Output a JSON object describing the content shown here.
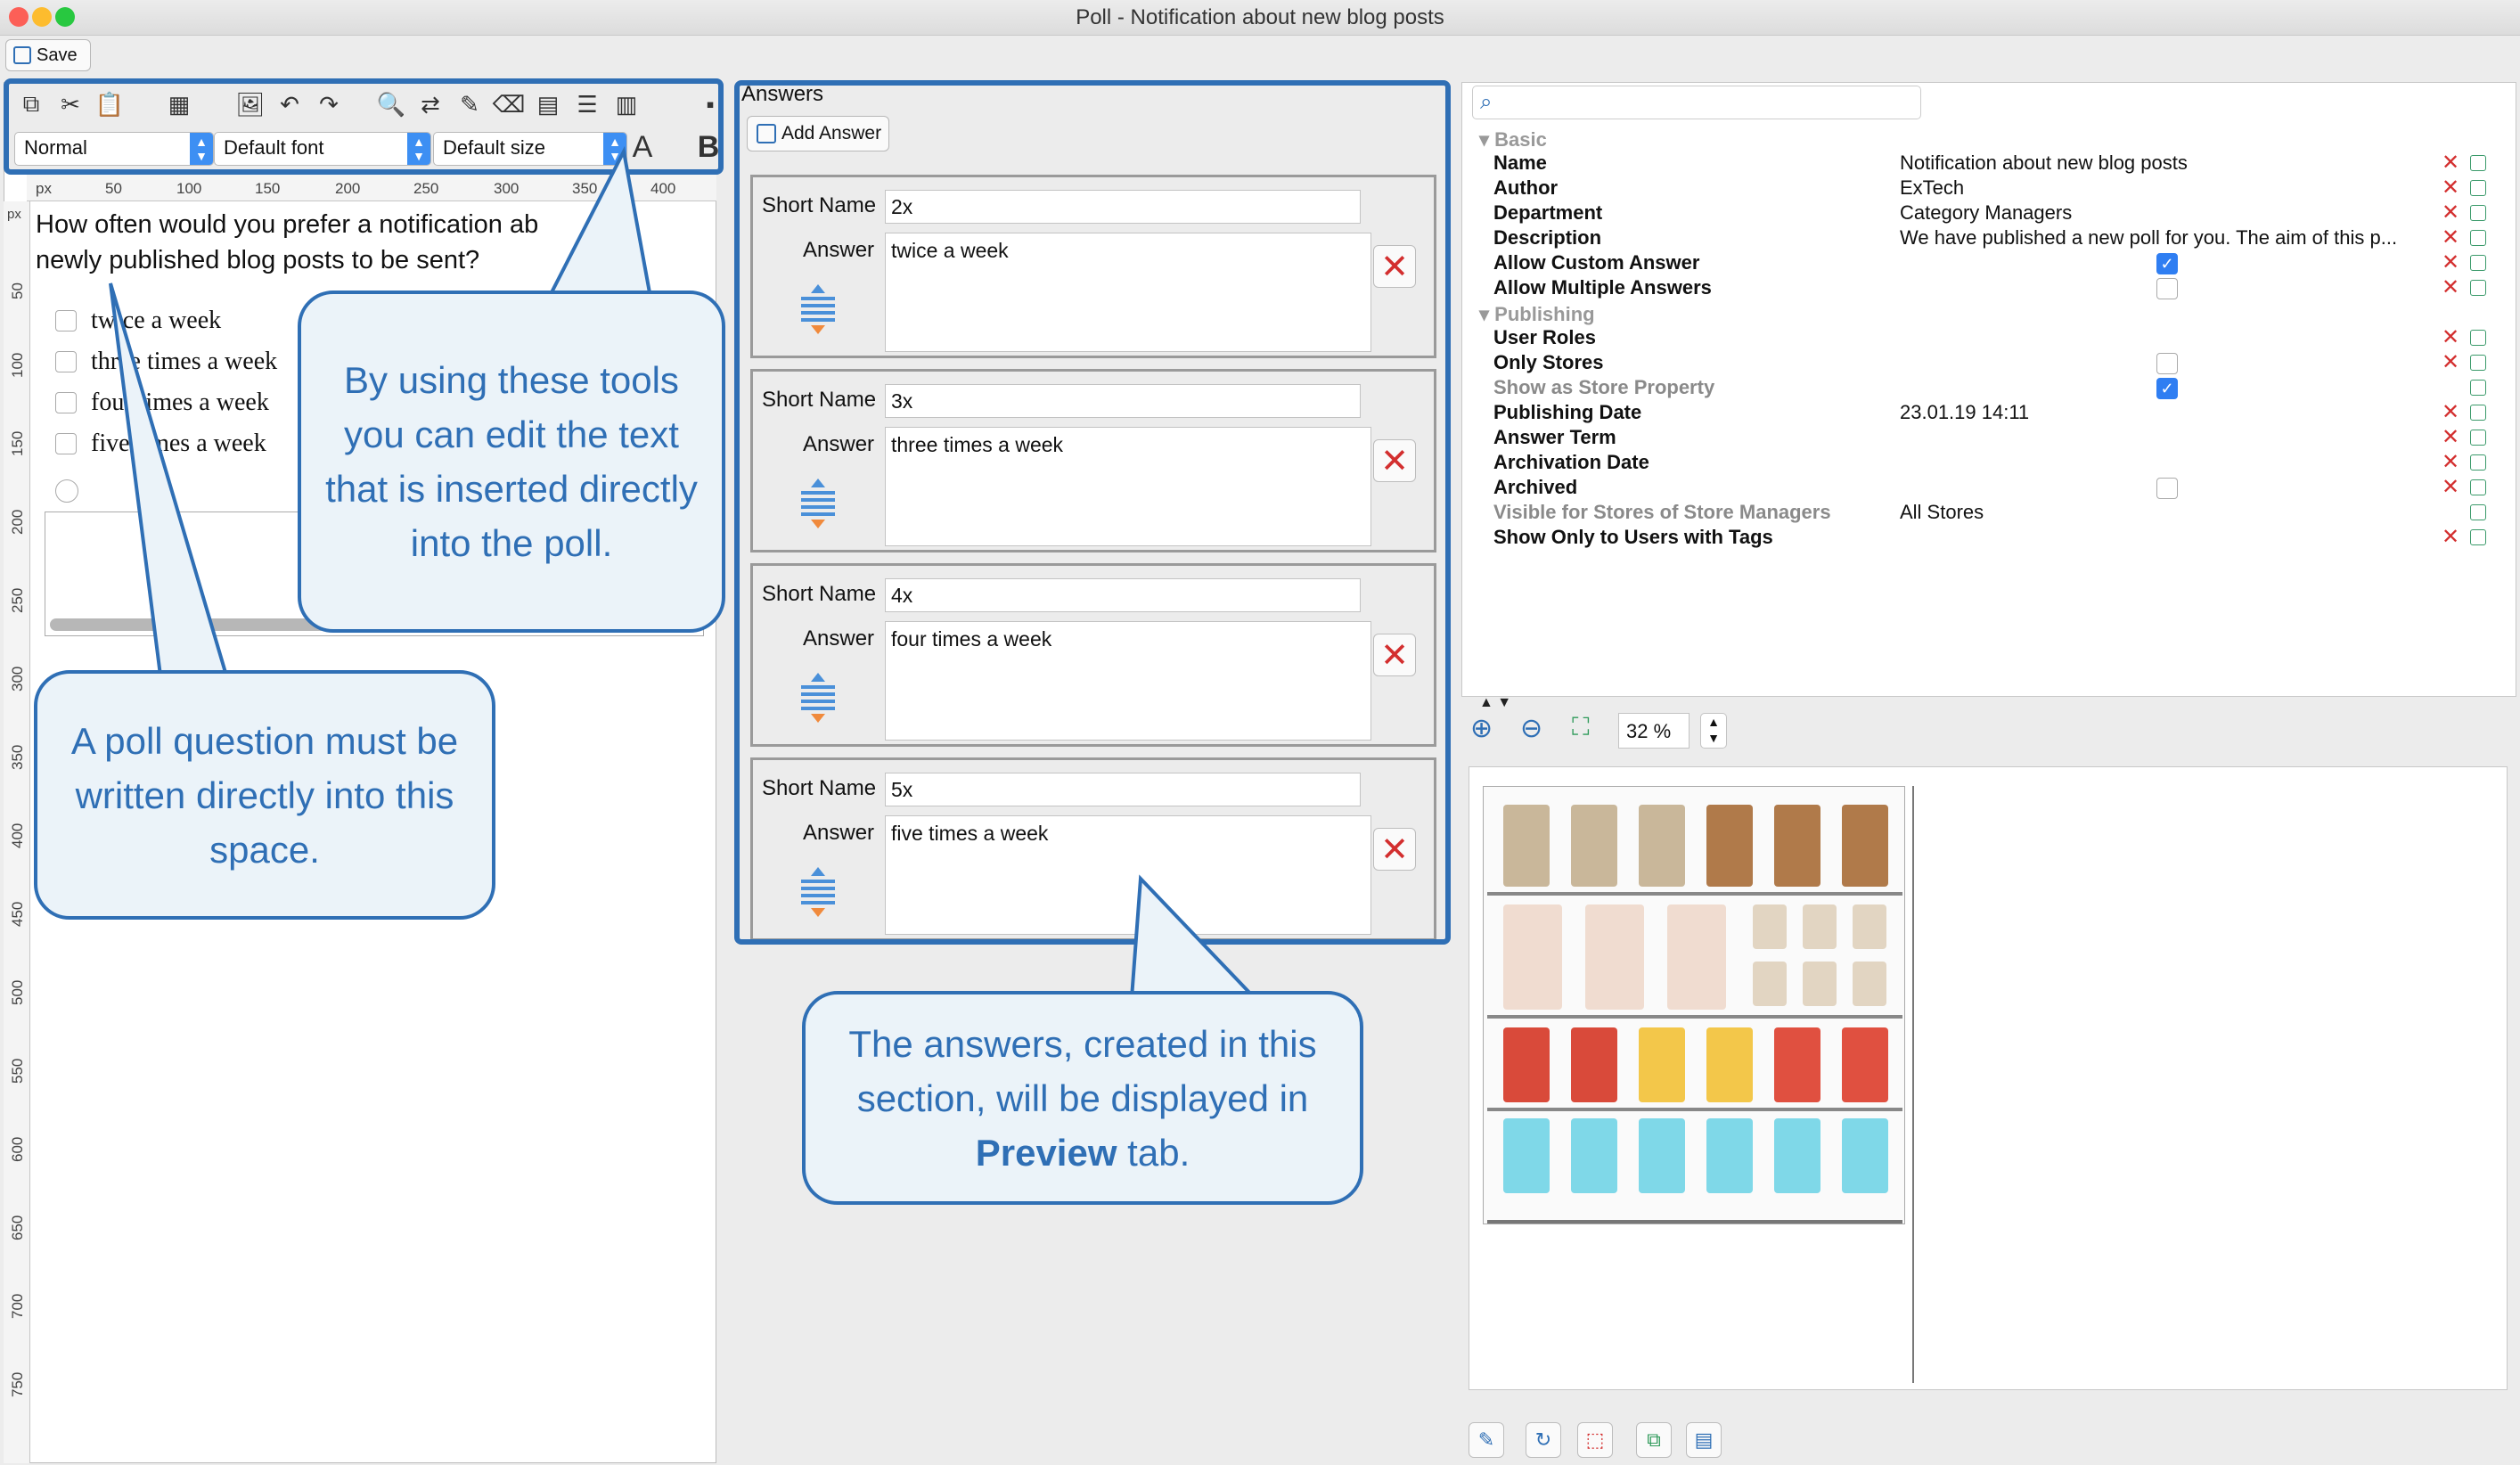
{
  "window": {
    "title": "Poll - Notification about new blog posts"
  },
  "toolbar": {
    "save_label": "Save",
    "style_select": "Normal",
    "font_select": "Default font",
    "size_select": "Default size",
    "font_color_glyph": "A",
    "bold_glyph": "B"
  },
  "ruler": {
    "unit": "px",
    "top_ticks": [
      "50",
      "100",
      "150",
      "200",
      "250",
      "300",
      "350",
      "400"
    ],
    "left_ticks": [
      "50",
      "100",
      "150",
      "200",
      "250",
      "300",
      "350",
      "400",
      "450",
      "500",
      "550",
      "600",
      "650",
      "700",
      "750"
    ]
  },
  "editor": {
    "question_line1": "How often would you prefer a notification ab",
    "question_line2": "newly published blog posts to be sent?",
    "options": [
      "twice a week",
      "three times a week",
      "four times a week",
      "five times a week"
    ]
  },
  "answers": {
    "title": "Answers",
    "add_label": "Add Answer",
    "short_name_label": "Short Name",
    "answer_label": "Answer",
    "items": [
      {
        "short_name": "2x",
        "answer": "twice a week"
      },
      {
        "short_name": "3x",
        "answer": "three times a week"
      },
      {
        "short_name": "4x",
        "answer": "four times a week"
      },
      {
        "short_name": "5x",
        "answer": "five times a week"
      }
    ]
  },
  "callouts": {
    "tools_text": "By using these tools you can edit the text that is inserted directly into the poll.",
    "question_text": "A poll question must be written directly into this space.",
    "answers_text_before": "The answers, created in this section, will be displayed in ",
    "answers_text_bold": "Preview",
    "answers_text_after": " tab."
  },
  "properties": {
    "section_basic": "Basic",
    "section_publishing": "Publishing",
    "rows": [
      {
        "label": "Name",
        "value": "Notification about new blog posts"
      },
      {
        "label": "Author",
        "value": "ExTech"
      },
      {
        "label": "Department",
        "value": "Category Managers"
      },
      {
        "label": "Description",
        "value": "We have published a new poll for you. The aim of this p..."
      },
      {
        "label": "Allow Custom Answer",
        "value": "",
        "checked": true
      },
      {
        "label": "Allow Multiple Answers",
        "value": "",
        "checked": false
      },
      {
        "label": "User Roles",
        "value": ""
      },
      {
        "label": "Only Stores",
        "value": "",
        "checked": false
      },
      {
        "label": "Show as Store Property",
        "value": "",
        "checked": true
      },
      {
        "label": "Publishing Date",
        "value": "23.01.19 14:11"
      },
      {
        "label": "Answer Term",
        "value": ""
      },
      {
        "label": "Archivation Date",
        "value": ""
      },
      {
        "label": "Archived",
        "value": "",
        "checked": false
      },
      {
        "label": "Visible for Stores of Store Managers",
        "value": "All Stores"
      },
      {
        "label": "Show Only to Users with Tags",
        "value": ""
      }
    ]
  },
  "preview": {
    "zoom": "32 %"
  },
  "colors": {
    "accent": "#2f6fb5",
    "callout_bg": "#ebf3f9",
    "delete": "#d32f2f",
    "select_arrow": "#3d8ff3"
  }
}
